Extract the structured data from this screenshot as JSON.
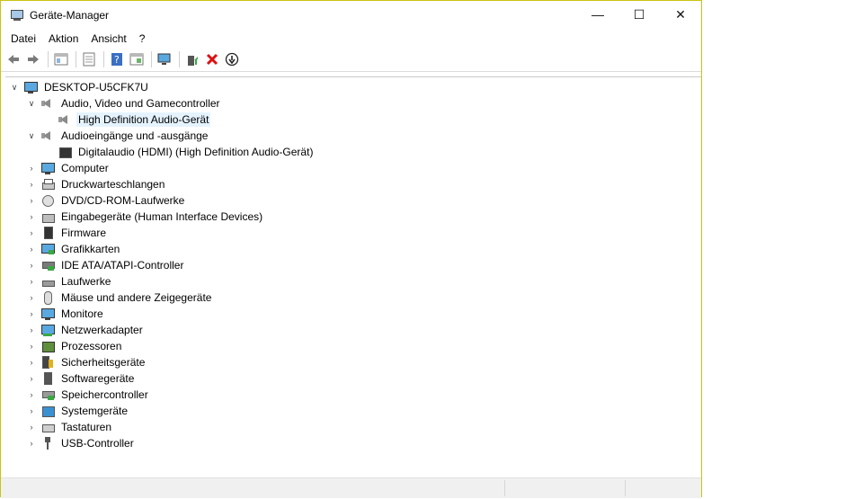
{
  "window": {
    "title": "Geräte-Manager",
    "buttons": {
      "minimize": "—",
      "maximize": "☐",
      "close": "✕"
    }
  },
  "menu": [
    "Datei",
    "Aktion",
    "Ansicht",
    "?"
  ],
  "toolbar": [
    "back-icon",
    "forward-icon",
    "sep",
    "properties-icon",
    "sep",
    "console-tree-icon",
    "sep",
    "help-icon",
    "view-icon",
    "sep",
    "scan-hardware-icon",
    "sep",
    "update-driver-icon",
    "uninstall-icon",
    "disable-icon"
  ],
  "tree": {
    "root": "DESKTOP-U5CFK7U",
    "nodes": [
      {
        "label": "Audio, Video und Gamecontroller",
        "level": 1,
        "expanded": true,
        "icon": "speaker-icon"
      },
      {
        "label": "High Definition Audio-Gerät",
        "level": 2,
        "selected": true,
        "icon": "speaker-icon"
      },
      {
        "label": "Audioeingänge und -ausgänge",
        "level": 1,
        "expanded": true,
        "icon": "speaker-icon"
      },
      {
        "label": "Digitalaudio (HDMI) (High Definition Audio-Gerät)",
        "level": 2,
        "icon": "display-icon"
      },
      {
        "label": "Computer",
        "level": 1,
        "icon": "computer-icon"
      },
      {
        "label": "Druckwarteschlangen",
        "level": 1,
        "icon": "printer-icon"
      },
      {
        "label": "DVD/CD-ROM-Laufwerke",
        "level": 1,
        "icon": "disc-icon"
      },
      {
        "label": "Eingabegeräte (Human Interface Devices)",
        "level": 1,
        "icon": "hid-icon"
      },
      {
        "label": "Firmware",
        "level": 1,
        "icon": "chip-icon"
      },
      {
        "label": "Grafikkarten",
        "level": 1,
        "icon": "graphics-card-icon"
      },
      {
        "label": "IDE ATA/ATAPI-Controller",
        "level": 1,
        "icon": "ide-icon"
      },
      {
        "label": "Laufwerke",
        "level": 1,
        "icon": "drive-icon"
      },
      {
        "label": "Mäuse und andere Zeigegeräte",
        "level": 1,
        "icon": "mouse-icon"
      },
      {
        "label": "Monitore",
        "level": 1,
        "icon": "monitor-icon"
      },
      {
        "label": "Netzwerkadapter",
        "level": 1,
        "icon": "network-icon"
      },
      {
        "label": "Prozessoren",
        "level": 1,
        "icon": "processor-icon"
      },
      {
        "label": "Sicherheitsgeräte",
        "level": 1,
        "icon": "security-icon"
      },
      {
        "label": "Softwaregeräte",
        "level": 1,
        "icon": "software-device-icon"
      },
      {
        "label": "Speichercontroller",
        "level": 1,
        "icon": "storage-controller-icon"
      },
      {
        "label": "Systemgeräte",
        "level": 1,
        "icon": "system-icon"
      },
      {
        "label": "Tastaturen",
        "level": 1,
        "icon": "keyboard-icon"
      },
      {
        "label": "USB-Controller",
        "level": 1,
        "icon": "usb-icon"
      }
    ]
  },
  "colors": {
    "window_border": "#c9c414",
    "selection": "#e5f3ff",
    "accent_blue": "#3a7fd0"
  }
}
